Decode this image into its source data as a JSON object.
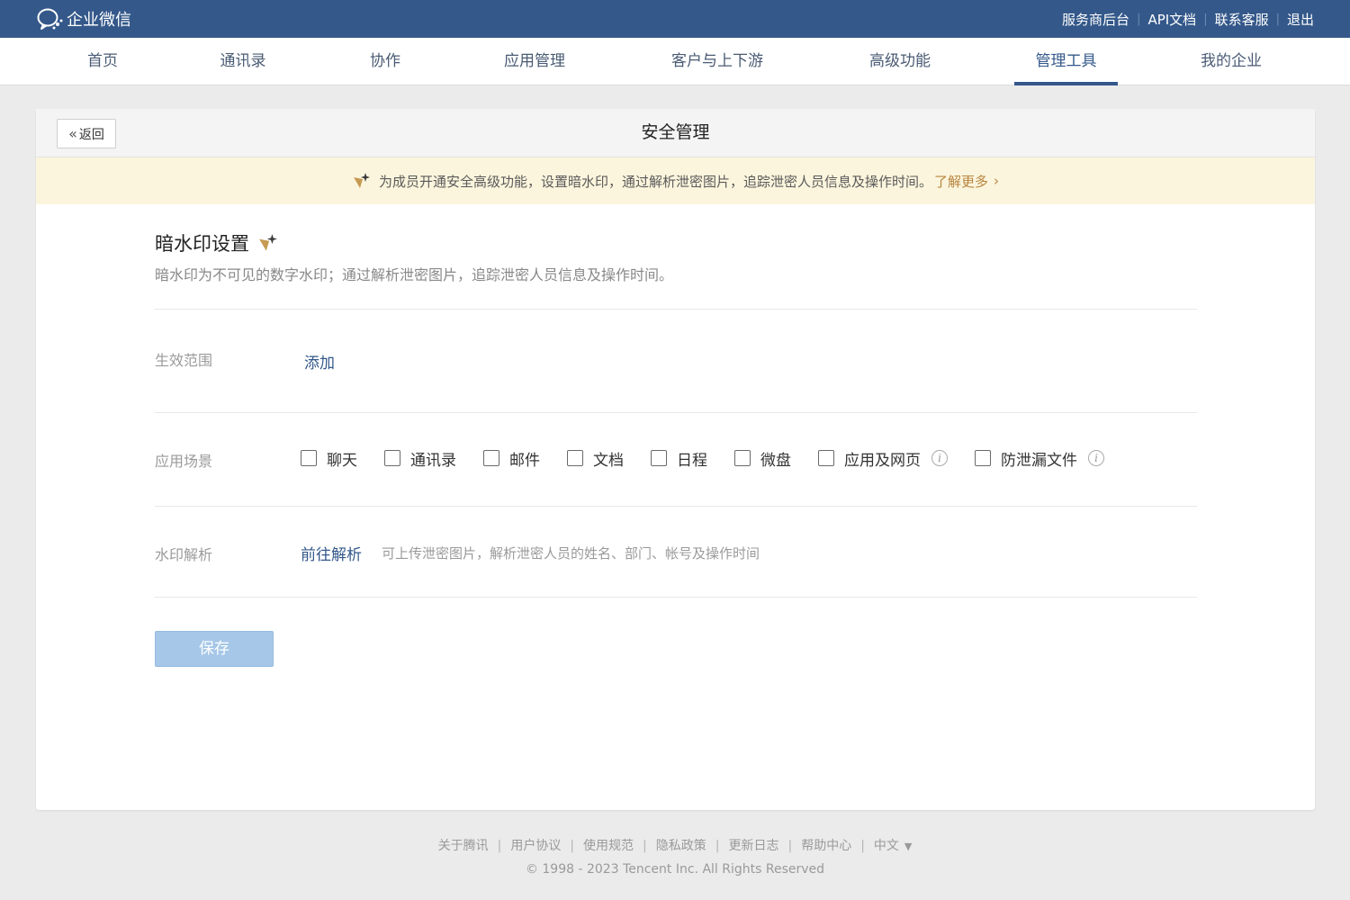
{
  "topbar": {
    "logo_text": "企业微信",
    "links": [
      "服务商后台",
      "API文档",
      "联系客服",
      "退出"
    ]
  },
  "nav": {
    "items": [
      "首页",
      "通讯录",
      "协作",
      "应用管理",
      "客户与上下游",
      "高级功能",
      "管理工具",
      "我的企业"
    ],
    "active": "管理工具"
  },
  "header": {
    "back_label": "返回",
    "title": "安全管理"
  },
  "notice": {
    "text": "为成员开通安全高级功能，设置暗水印，通过解析泄密图片，追踪泄密人员信息及操作时间。",
    "link": "了解更多"
  },
  "watermark": {
    "title": "暗水印设置",
    "desc": "暗水印为不可见的数字水印；通过解析泄密图片，追踪泄密人员信息及操作时间。",
    "scope_label": "生效范围",
    "scope_add": "添加",
    "scene_label": "应用场景",
    "scenes": [
      "聊天",
      "通讯录",
      "邮件",
      "文档",
      "日程",
      "微盘",
      "应用及网页",
      "防泄漏文件"
    ],
    "parse_label": "水印解析",
    "parse_link": "前往解析",
    "parse_desc": "可上传泄密图片，解析泄密人员的姓名、部门、帐号及操作时间",
    "save_label": "保存"
  },
  "footer": {
    "links": [
      "关于腾讯",
      "用户协议",
      "使用规范",
      "隐私政策",
      "更新日志",
      "帮助中心",
      "中文"
    ],
    "copyright": "© 1998 - 2023 Tencent Inc. All Rights Reserved"
  },
  "colors": {
    "brand": "#34588a",
    "notice_bg": "#fcf5dd",
    "notice_link": "#b7853f",
    "save_disabled": "#a6c7e8"
  }
}
